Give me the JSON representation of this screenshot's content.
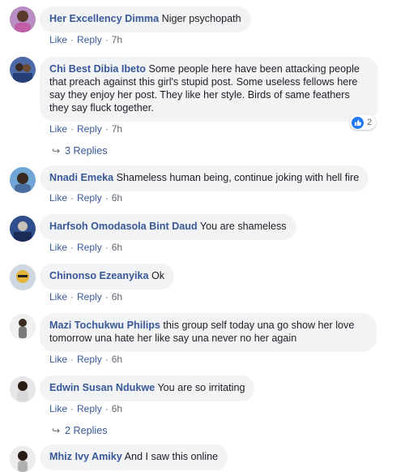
{
  "comments": [
    {
      "author": "Her Excellency Dimma",
      "text": "Niger psychopath",
      "like": "Like",
      "reply": "Reply",
      "time": "7h"
    },
    {
      "author": "Chi Best Dibia Ibeto",
      "text": "Some people here have been attacking people that preach against this girl's stupid post. Some useless fellows here say they enjoy her post. They like her style. Birds of same feathers they say fluck together.",
      "like": "Like",
      "reply": "Reply",
      "time": "7h",
      "reaction_count": "2",
      "replies": "3 Replies"
    },
    {
      "author": "Nnadi Emeka",
      "text": "Shameless human being, continue joking with hell fire",
      "like": "Like",
      "reply": "Reply",
      "time": "6h"
    },
    {
      "author": "Harfsoh Omodasola Bint Daud",
      "text": "You are shameless",
      "like": "Like",
      "reply": "Reply",
      "time": "6h"
    },
    {
      "author": "Chinonso Ezeanyika",
      "text": "Ok",
      "like": "Like",
      "reply": "Reply",
      "time": "6h"
    },
    {
      "author": "Mazi Tochukwu Philips",
      "text": "this group self today una go show her love tomorrow una hate her like say una never no her again",
      "like": "Like",
      "reply": "Reply",
      "time": "6h"
    },
    {
      "author": "Edwin Susan Ndukwe",
      "text": "You are so irritating",
      "like": "Like",
      "reply": "Reply",
      "time": "6h",
      "replies": "2 Replies"
    },
    {
      "author": "Mhiz Ivy Amiky",
      "text": "And I saw this online"
    }
  ],
  "colors": {
    "link": "#385898",
    "bubble": "#f2f3f5",
    "meta": "#606770",
    "like_blue": "#2078f4"
  },
  "icons": {
    "reaction": "thumbs-up-icon",
    "replies_arrow": "reply-arrow-icon"
  }
}
